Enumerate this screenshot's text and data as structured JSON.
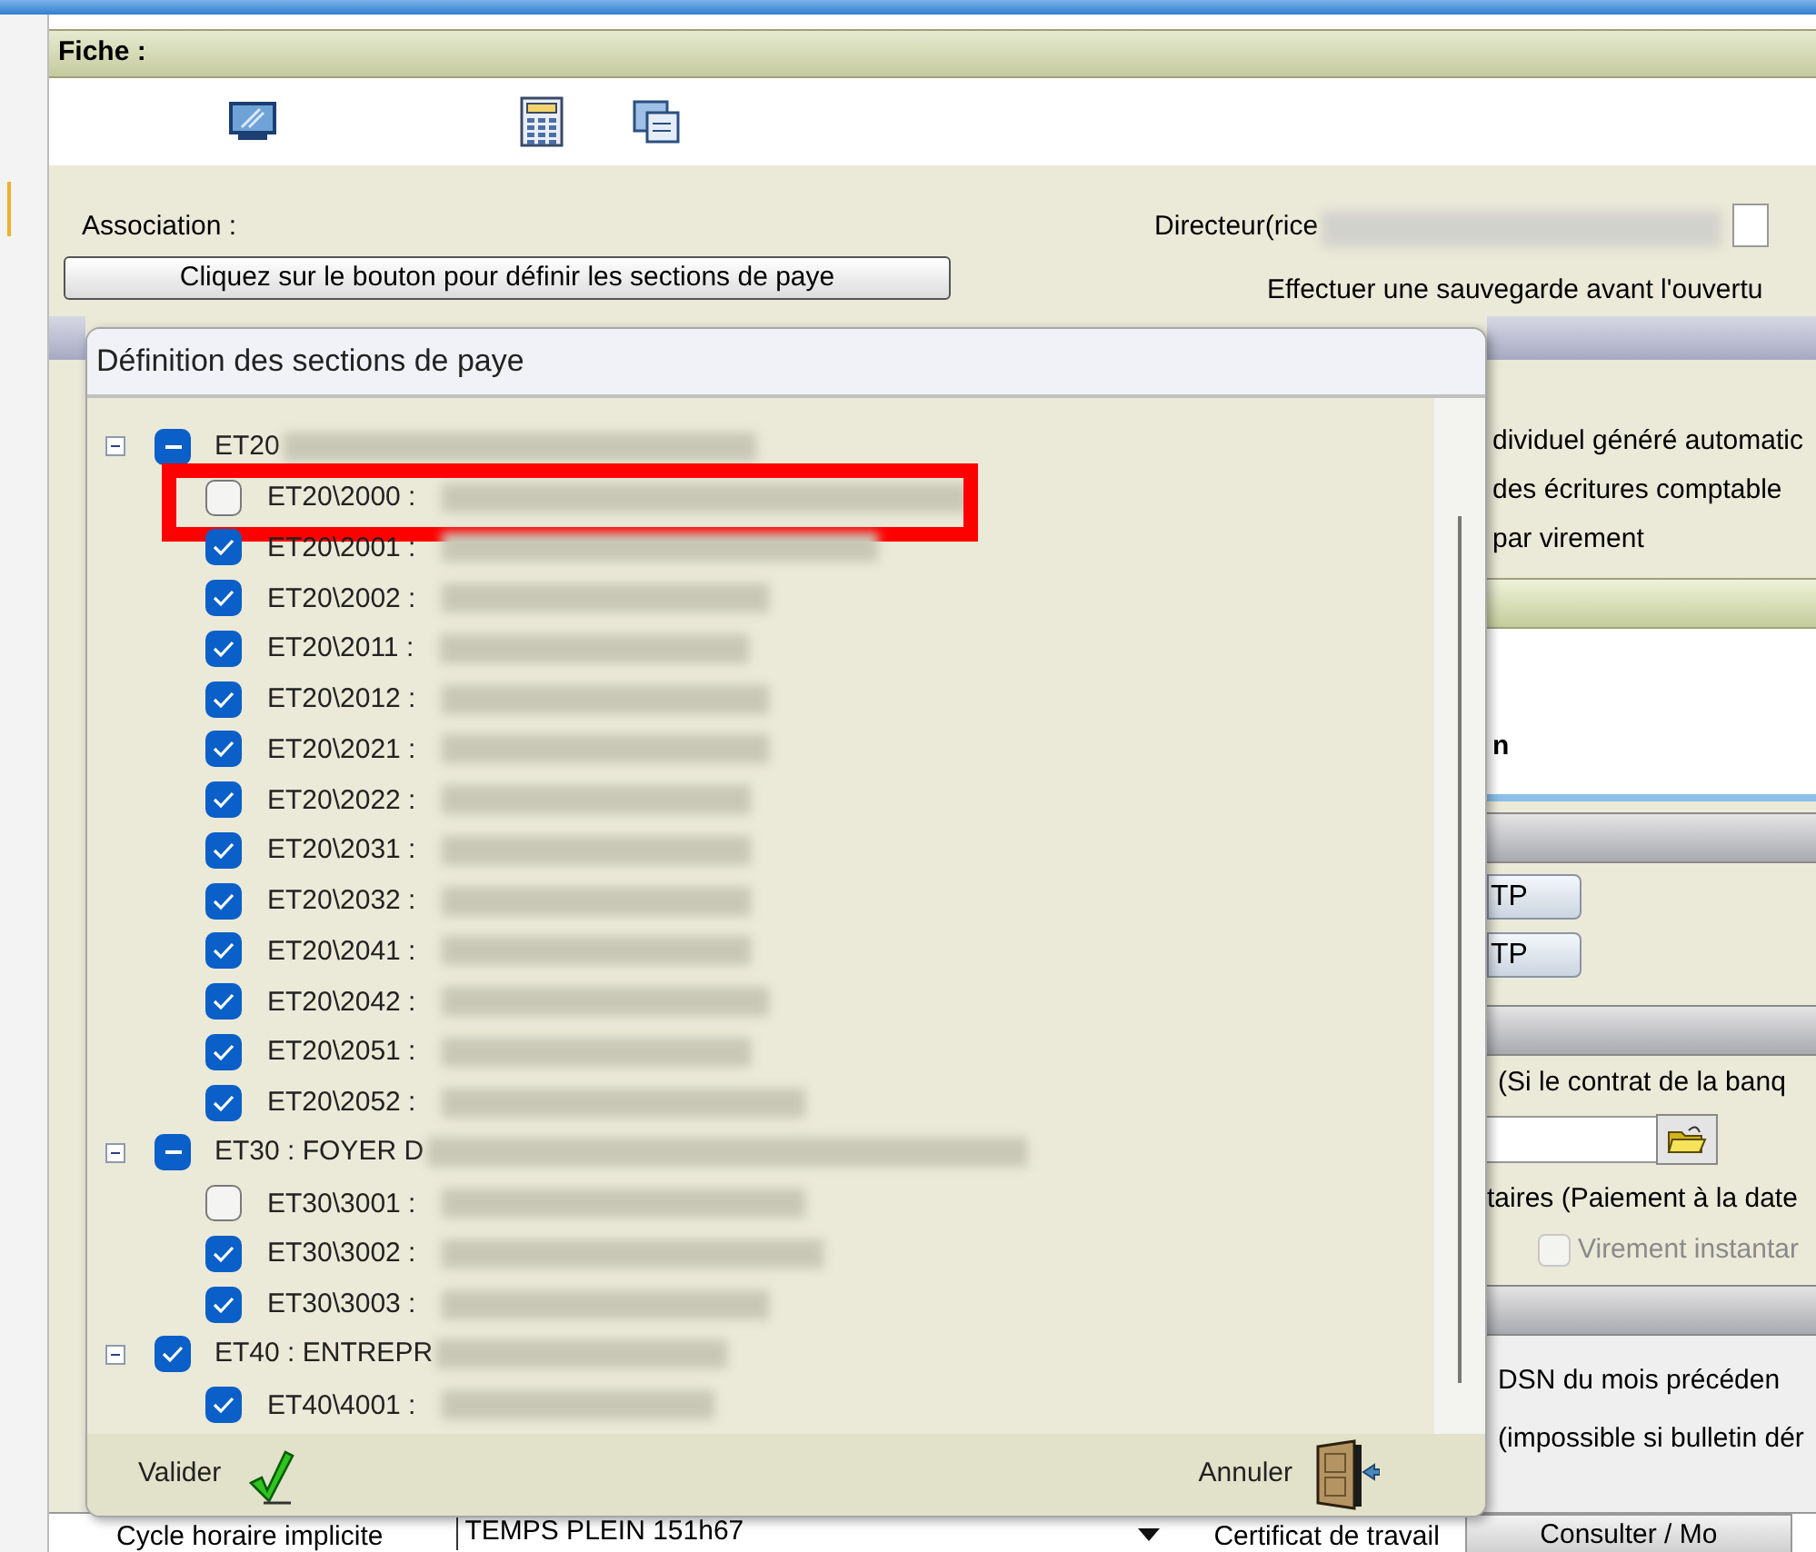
{
  "window": {
    "title": "Fiche :"
  },
  "form": {
    "association_label": "Association :",
    "director_label": "Directeur(rice",
    "sections_button": "Cliquez sur le bouton pour définir les sections de paye",
    "backup_notice": "Effectuer une sauvegarde avant l'ouvertu"
  },
  "background_panel": {
    "info_lines": [
      "dividuel généré automatic",
      "des écritures comptable",
      "par virement"
    ],
    "bold_text": "n",
    "buttons": [
      "TP",
      "TP"
    ],
    "bank_note": "(Si le contrat de la banq",
    "payment_note": "taires (Paiement à la date",
    "instant_transfer": {
      "label": "Virement instantar",
      "checked": false,
      "disabled": true
    },
    "dsn_lines": [
      "DSN du mois précéden",
      "(impossible si bulletin dér"
    ]
  },
  "footer_row": {
    "cycle_label": "Cycle horaire implicite",
    "cycle_value": "TEMPS PLEIN 151h67",
    "certificate_label": "Certificat de travail",
    "consult_button": "Consulter / Mo"
  },
  "dialog": {
    "title": "Définition des sections de paye",
    "tree": [
      {
        "label": "ET20",
        "checked": false,
        "indeterminate": true,
        "expanded": true,
        "children": [
          {
            "label": "ET20\\2000 :",
            "checked": false,
            "highlighted": true
          },
          {
            "label": "ET20\\2001 :",
            "checked": true,
            "highlighted": false
          },
          {
            "label": "ET20\\2002 :",
            "checked": true,
            "highlighted": false
          },
          {
            "label": "ET20\\2011 :",
            "checked": true,
            "highlighted": false
          },
          {
            "label": "ET20\\2012 :",
            "checked": true,
            "highlighted": false
          },
          {
            "label": "ET20\\2021 :",
            "checked": true,
            "highlighted": false
          },
          {
            "label": "ET20\\2022 :",
            "checked": true,
            "highlighted": false
          },
          {
            "label": "ET20\\2031 :",
            "checked": true,
            "highlighted": false
          },
          {
            "label": "ET20\\2032 :",
            "checked": true,
            "highlighted": false
          },
          {
            "label": "ET20\\2041 :",
            "checked": true,
            "highlighted": false
          },
          {
            "label": "ET20\\2042 :",
            "checked": true,
            "highlighted": false
          },
          {
            "label": "ET20\\2051 :",
            "checked": true,
            "highlighted": false
          },
          {
            "label": "ET20\\2052 :",
            "checked": true,
            "highlighted": false
          }
        ]
      },
      {
        "label": "ET30 : FOYER D",
        "checked": false,
        "indeterminate": true,
        "expanded": true,
        "children": [
          {
            "label": "ET30\\3001 :",
            "checked": false,
            "highlighted": false
          },
          {
            "label": "ET30\\3002 :",
            "checked": true,
            "highlighted": false
          },
          {
            "label": "ET30\\3003 :",
            "checked": true,
            "highlighted": false
          }
        ]
      },
      {
        "label": "ET40 : ENTREPR",
        "checked": true,
        "indeterminate": false,
        "expanded": true,
        "children": [
          {
            "label": "ET40\\4001 :",
            "checked": true,
            "highlighted": false
          }
        ]
      }
    ],
    "validate_button": "Valider",
    "cancel_button": "Annuler"
  }
}
